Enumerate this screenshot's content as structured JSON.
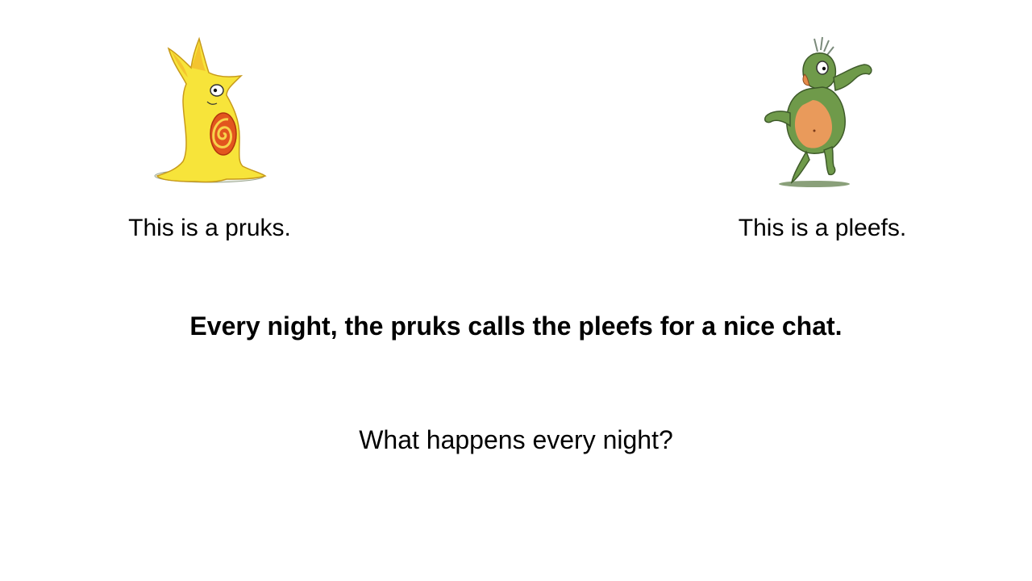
{
  "slide": {
    "left_caption": "This is a pruks.",
    "right_caption": "This is a pleefs.",
    "statement": "Every night, the pruks calls the pleefs for a nice chat.",
    "question": "What happens every night?"
  },
  "colors": {
    "background": "#ffffff",
    "text": "#000000",
    "pruks_body": "#f7e43a",
    "pruks_spiral": "#e2551e",
    "pleefs_body": "#6f9a4a",
    "pleefs_belly": "#ef9a5c"
  }
}
